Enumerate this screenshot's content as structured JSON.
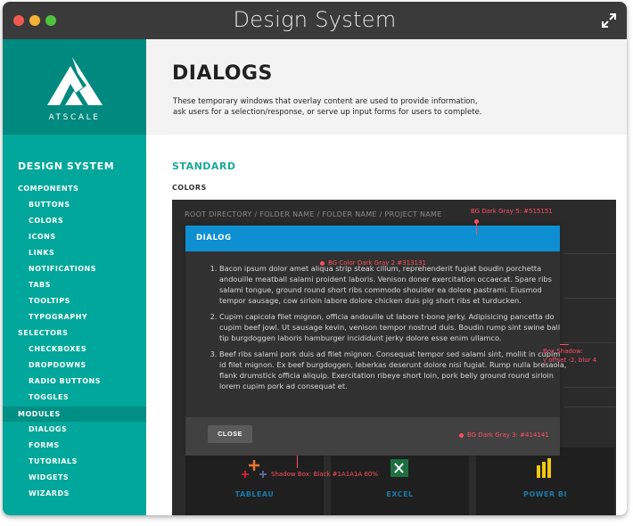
{
  "window": {
    "title": "Design System"
  },
  "brand": {
    "logo_text": "ATSCALE"
  },
  "sidebar": {
    "title": "DESIGN SYSTEM",
    "groups": [
      {
        "label": "COMPONENTS",
        "items": [
          "BUTTONS",
          "COLORS",
          "ICONS",
          "LINKS",
          "NOTIFICATIONS",
          "TABS",
          "TOOLTIPS",
          "TYPOGRAPHY"
        ]
      },
      {
        "label": "SELECTORS",
        "items": [
          "CHECKBOXES",
          "DROPDOWNS",
          "RADIO BUTTONS",
          "TOGGLES"
        ]
      },
      {
        "label": "MODULES",
        "items": [
          "DIALOGS",
          "FORMS",
          "TUTORIALS",
          "WIDGETS",
          "WIZARDS"
        ]
      }
    ],
    "active_group": "MODULES"
  },
  "page": {
    "title": "DIALOGS",
    "description": "These temporary windows that overlay content are used to provide information, ask users for a selection/response, or serve up input forms for users to complete.",
    "section": "STANDARD",
    "subsection": "COLORS"
  },
  "stage": {
    "breadcrumb": "ROOT DIRECTORY / FOLDER NAME / FOLDER NAME / PROJECT NAME",
    "tiles": [
      "TABLEAU",
      "EXCEL",
      "POWER BI"
    ]
  },
  "dialog": {
    "title": "DIALOG",
    "items": [
      "Bacon ipsum dolor amet aliqua strip steak cillum, reprehenderit fugiat boudin porchetta andouille meatball salami proident laboris. Venison doner exercitation occaecat. Spare ribs salami tongue, ground round short ribs commodo shoulder ea dolore pastrami. Eiusmod tempor sausage, cow sirloin labore dolore chicken duis pig short ribs et turducken.",
      "Cupim capicola filet mignon, officia andouille ut labore t-bone jerky. Adipisicing pancetta do cupim beef jowl. Ut sausage kevin, venison tempor nostrud duis. Boudin rump sint swine ball tip burgdoggen laboris hamburger incididunt jerky dolore esse enim ullamco.",
      "Beef ribs salami pork duis ad filet mignon. Consequat tempor sed salami sint, mollit in cupim id filet mignon. Ex beef burgdoggen, leberkas deserunt dolore nisi fugiat. Rump nulla bresaola, flank drumstick officia aliquip. Exercitation ribeye short loin, pork belly ground round sirloin lorem cupim pork ad consequat et."
    ],
    "close_label": "CLOSE"
  },
  "annotations": {
    "bg_dark_gray_5": "BG Dark Gray 5: #515151",
    "bg_color_dark_gray_2": "BG Color Dark Gray 2 #313131",
    "box_shadow_1": "Box Shadow:",
    "box_shadow_2": "y offset -2, blur 4",
    "bg_dark_gray_3": "BG Dark Gray 3: #414141",
    "shadow_box": "Shadow Box: Black #1A1A1A 60%"
  },
  "colors": {
    "sidebar": "#00a79a",
    "logo_bg": "#00897e",
    "accent": "#1aa897",
    "dialog_header": "#0d8fd1",
    "annotation": "#ff4e63",
    "dark_gray_2": "#313131",
    "dark_gray_3": "#414141",
    "dark_gray_5": "#515151"
  }
}
